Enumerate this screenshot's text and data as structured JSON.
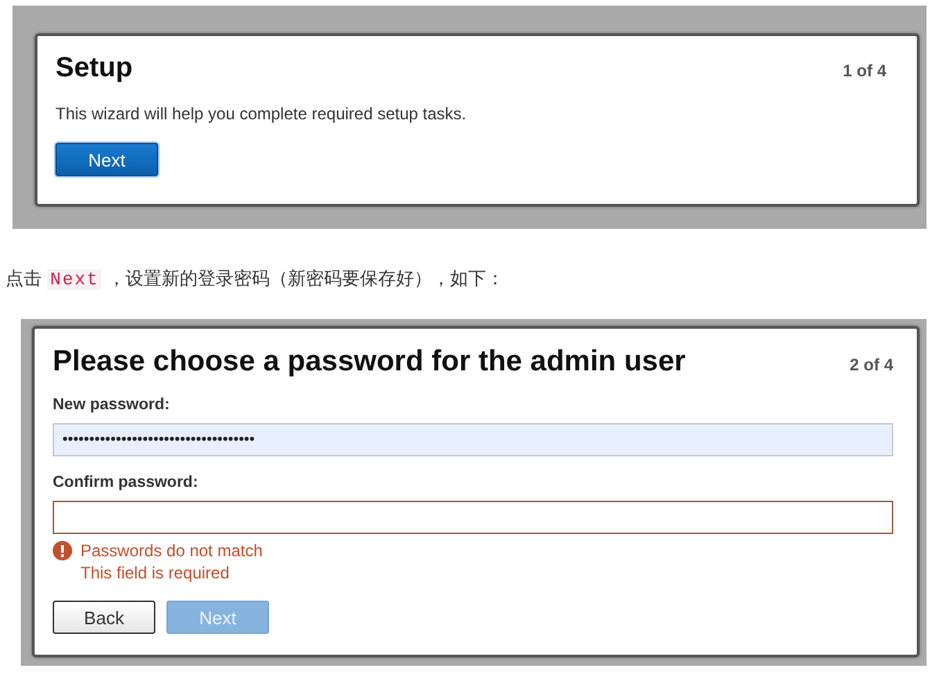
{
  "setup_screen": {
    "title": "Setup",
    "step": "1 of 4",
    "description": "This wizard will help you complete required setup tasks.",
    "buttons": [
      {
        "label": "Next",
        "kind": "primary",
        "disabled": false
      }
    ]
  },
  "caption": {
    "before": "点击 ",
    "code": "Next",
    "after": " ，设置新的登录密码（新密码要保存好），如下："
  },
  "password_screen": {
    "title": "Please choose a password for the admin user",
    "step": "2 of 4",
    "fields": [
      {
        "label": "New password:",
        "value": "••••••••••••••••••••••••••••••••••••",
        "invalid": false,
        "autofilled": true
      },
      {
        "label": "Confirm password:",
        "invalid": true,
        "autofilled": false
      }
    ],
    "errors": [
      "Passwords do not match",
      "This field is required"
    ],
    "buttons": [
      {
        "label": "Back",
        "kind": "secondary",
        "disabled": false
      },
      {
        "label": "Next",
        "kind": "primary",
        "disabled": true
      }
    ]
  }
}
